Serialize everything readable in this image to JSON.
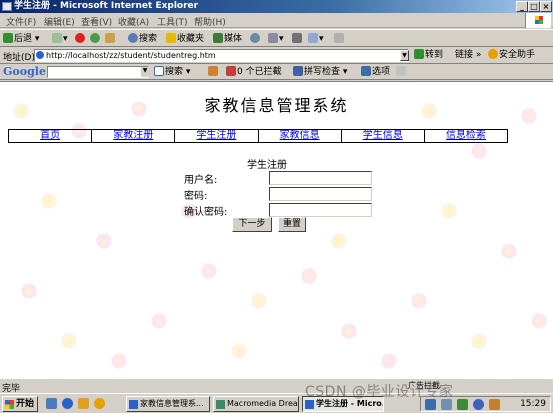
{
  "window": {
    "title": "学生注册 - Microsoft Internet Explorer"
  },
  "menu": [
    "文件(F)",
    "编辑(E)",
    "查看(V)",
    "收藏(A)",
    "工具(T)",
    "帮助(H)"
  ],
  "toolbar": {
    "back": "后退",
    "search": "搜索",
    "favorites": "收藏夹",
    "media": "媒体"
  },
  "address": {
    "label": "地址(D)",
    "url": "http://localhost/zz/student/studentreg.htm",
    "go": "转到",
    "links": "链接",
    "assistant": "安全助手"
  },
  "google": {
    "logo": "Google",
    "search": "搜索",
    "blocked": "0 个已拦截",
    "spellcheck": "拼写检查",
    "options": "选项"
  },
  "page": {
    "title": "家教信息管理系统",
    "nav": [
      "首页",
      "家教注册",
      "学生注册",
      "家教信息",
      "学生信息",
      "信息检索"
    ],
    "form": {
      "heading": "学生注册",
      "username_label": "用户名:",
      "password_label": "密码:",
      "confirm_label": "确认密码:",
      "next_button": "下一步",
      "reset_button": "重置"
    }
  },
  "status": {
    "text": "完毕"
  },
  "taskbar": {
    "start": "开始",
    "tasks": [
      "家教信息管理系...",
      "Macromedia Drea...",
      "学生注册 - Micro..."
    ],
    "clock": "15:29",
    "tray_ad": "广告拦截"
  },
  "watermark": "CSDN @毕业设计专家"
}
